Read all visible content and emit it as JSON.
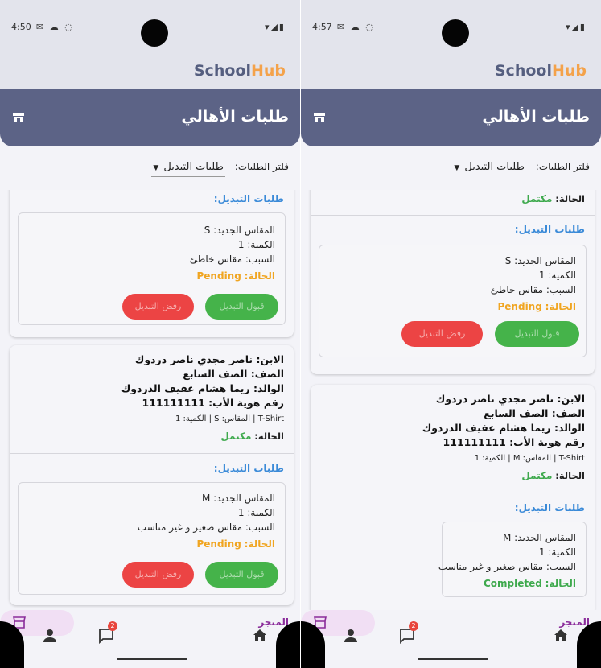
{
  "screens": [
    {
      "status": {
        "time": "4:50",
        "left_icons": "✉ ☁ ◌",
        "right_icons": "▾◢▮"
      },
      "brand": {
        "school": "School",
        "hub": "Hub"
      },
      "header": {
        "title": "طلبات الأهالي"
      },
      "filter": {
        "label": "فلتر الطلبات:",
        "value": "طلبات التبديل"
      },
      "items": {
        "first_section_title": "طلبات التبديل:",
        "first_exchange": {
          "size": "المقاس الجديد: S",
          "qty": "الكمية: 1",
          "reason": "السبب: مقاس خاطئ",
          "status_label": "الحالة:",
          "status_value": "Pending",
          "accept": "قبول التبديل",
          "reject": "رفض التبديل"
        },
        "child": "الابن: ناصر مجدي ناصر دردوك",
        "grade": "الصف: الصف السابع",
        "parent": "الوالد: ريما هشام عفيف الدردوك",
        "father_id": "رقم هوية الأب: 111111111",
        "product": "T-Shirt | المقاس: S | الكمية: 1",
        "order_status_label": "الحالة:",
        "order_status_value": "مكتمل",
        "second_section_title": "طلبات التبديل:",
        "second_exchange": {
          "size": "المقاس الجديد: M",
          "qty": "الكمية: 1",
          "reason": "السبب: مقاس صغير و غير مناسب",
          "status_label": "الحالة:",
          "status_value": "Pending",
          "accept": "قبول التبديل",
          "reject": "رفض التبديل"
        }
      },
      "nav": {
        "store": "المتجر",
        "chat_badge": "2"
      }
    },
    {
      "status": {
        "time": "4:57",
        "left_icons": "✉ ☁ ◌",
        "right_icons": "▾◢▮"
      },
      "brand": {
        "school": "School",
        "hub": "Hub"
      },
      "header": {
        "title": "طلبات الأهالي"
      },
      "filter": {
        "label": "فلتر الطلبات:",
        "value": "طلبات التبديل"
      },
      "items": {
        "top_status_label": "الحالة:",
        "top_status_value": "مكتمل",
        "first_section_title": "طلبات التبديل:",
        "first_exchange": {
          "size": "المقاس الجديد: S",
          "qty": "الكمية: 1",
          "reason": "السبب: مقاس خاطئ",
          "status_label": "الحالة:",
          "status_value": "Pending",
          "accept": "قبول التبديل",
          "reject": "رفض التبديل"
        },
        "child": "الابن: ناصر مجدي ناصر دردوك",
        "grade": "الصف: الصف السابع",
        "parent": "الوالد: ريما هشام عفيف الدردوك",
        "father_id": "رقم هوية الأب: 111111111",
        "product": "T-Shirt | المقاس: M | الكمية: 1",
        "order_status_label": "الحالة:",
        "order_status_value": "مكتمل",
        "second_section_title": "طلبات التبديل:",
        "second_exchange": {
          "size": "المقاس الجديد: M",
          "qty": "الكمية: 1",
          "reason": "السبب: مقاس صغير و غير مناسب",
          "status_label": "الحالة:",
          "status_value": "Completed"
        }
      },
      "nav": {
        "store": "المتجر",
        "chat_badge": "2"
      }
    }
  ],
  "colors": {
    "header": "#5c6386",
    "brand_school": "#555e7f",
    "brand_hub": "#f4a24a",
    "accept": "#45b34a",
    "reject": "#ec4444",
    "completed": "#3ea94d",
    "pending": "#f0a521",
    "section_title": "#3a8ad8",
    "store_pill": "#f1dff4"
  },
  "icons": [
    "store-icon",
    "profile-icon",
    "chat-icon",
    "home-icon"
  ]
}
